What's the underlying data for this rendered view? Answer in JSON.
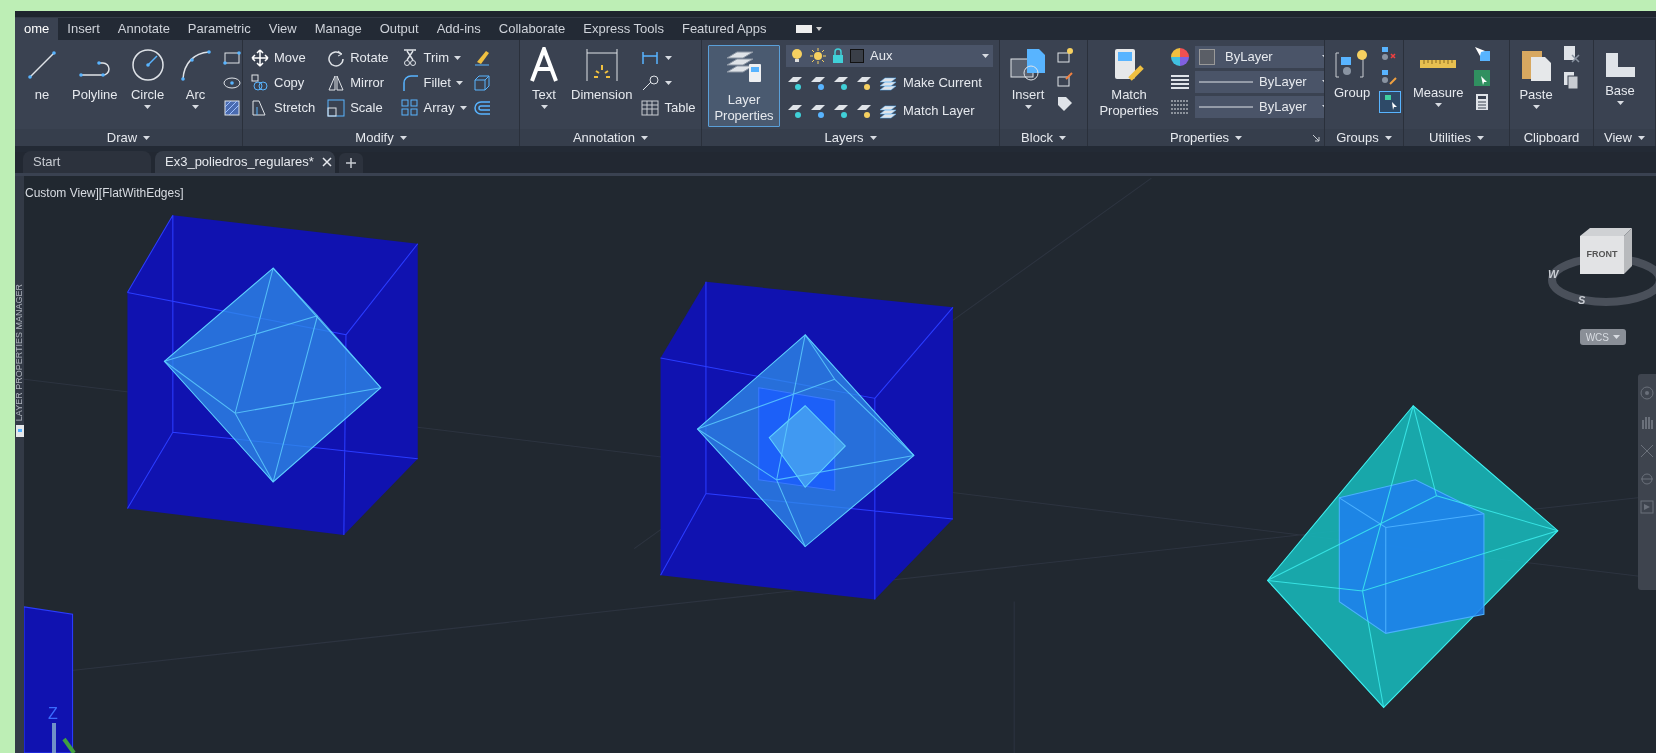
{
  "ribbon_tabs": [
    {
      "label": "ome",
      "selected": true
    },
    {
      "label": "Insert",
      "selected": false
    },
    {
      "label": "Annotate",
      "selected": false
    },
    {
      "label": "Parametric",
      "selected": false
    },
    {
      "label": "View",
      "selected": false
    },
    {
      "label": "Manage",
      "selected": false
    },
    {
      "label": "Output",
      "selected": false
    },
    {
      "label": "Add-ins",
      "selected": false
    },
    {
      "label": "Collaborate",
      "selected": false
    },
    {
      "label": "Express Tools",
      "selected": false
    },
    {
      "label": "Featured Apps",
      "selected": false
    }
  ],
  "draw": {
    "title": "Draw",
    "menu": true,
    "tools": [
      {
        "label": "ne",
        "dropdown": false
      },
      {
        "label": "Polyline",
        "dropdown": false
      },
      {
        "label": "Circle",
        "dropdown": true
      },
      {
        "label": "Arc",
        "dropdown": true
      }
    ]
  },
  "modify": {
    "title": "Modify",
    "menu": true,
    "tools": [
      {
        "label": "Move",
        "dropdown": false
      },
      {
        "label": "Rotate",
        "dropdown": false
      },
      {
        "label": "Trim",
        "dropdown": true
      },
      {
        "label": "Copy",
        "dropdown": false
      },
      {
        "label": "Mirror",
        "dropdown": false
      },
      {
        "label": "Fillet",
        "dropdown": true
      },
      {
        "label": "Stretch",
        "dropdown": false
      },
      {
        "label": "Scale",
        "dropdown": false
      },
      {
        "label": "Array",
        "dropdown": true
      }
    ]
  },
  "annotation": {
    "title": "Annotation",
    "menu": true,
    "text": {
      "label": "Text",
      "dropdown": true
    },
    "dimension": {
      "label": "Dimension"
    },
    "table": "Table"
  },
  "layers": {
    "title": "Layers",
    "menu": true,
    "layer_properties": {
      "label": "Layer Properties",
      "selected": true
    },
    "current_layer": "Aux",
    "actions": [
      "Make Current",
      "Match Layer"
    ]
  },
  "block": {
    "title": "Block",
    "menu": true,
    "insert": {
      "label": "Insert",
      "dropdown": true
    }
  },
  "properties": {
    "title": "Properties",
    "menu": true,
    "match_properties": "Match Properties",
    "color_setting": "ByLayer",
    "linetype": "ByLayer",
    "lineweight": "ByLayer"
  },
  "groups": {
    "title": "Groups",
    "menu": true,
    "group": "Group"
  },
  "utilities": {
    "title": "Utilities",
    "menu": true,
    "measure": {
      "label": "Measure",
      "dropdown": true
    }
  },
  "clipboard": {
    "title": "Clipboard",
    "menu": false,
    "paste": {
      "label": "Paste",
      "dropdown": true
    }
  },
  "view": {
    "title": "View",
    "menu": true,
    "base": {
      "label": "Base",
      "dropdown": true
    }
  },
  "file_tabs": [
    {
      "label": "Start",
      "selected": false,
      "closable": false
    },
    {
      "label": "Ex3_poliedros_regulares*",
      "selected": true,
      "closable": true
    }
  ],
  "viewport": {
    "label": "Custom View][FlatWithEdges]",
    "viewcube": {
      "face": "FRONT",
      "compass": [
        "W",
        "S"
      ]
    },
    "ucs_menu": "WCS",
    "axis_label": "Z"
  },
  "side_palette": "LAYER PROPERTIES MANAGER"
}
